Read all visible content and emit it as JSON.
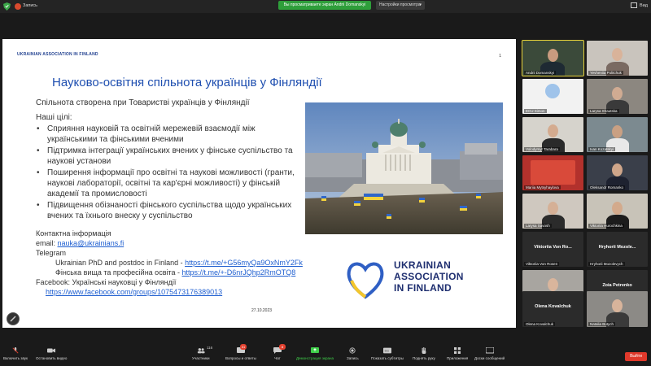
{
  "topbar": {
    "recording": "Запись",
    "share_notice": "Вы просматриваете экран Andrii Domanskyi",
    "view_options": "Настройки просмотра",
    "view_button": "Вид"
  },
  "slide": {
    "org": "UKRAINIAN ASSOCIATION IN FINLAND",
    "page": "1",
    "title": "Науково-освітня спільнота українців у Фінляндії",
    "intro": "Спільнота створена при Товаристві українців у Фінляндії",
    "goals_heading": "Наші цілі:",
    "goals": [
      "Сприяння науковій та освітній мережевій взаємодії між українськими та фінськими вченими",
      "Підтримка інтеграції українських вчених у фінське суспільство та наукові установи",
      "Поширення інформації про освітні та наукові можливості (гранти, наукові лабораторії, освітні та кар'єрні можливості) у фінській академії та промисловості",
      "Підвищення обізнаності фінського суспільства щодо українських вчених та їхнього внеску у суспільство"
    ],
    "contact_heading": "Контактна інформація",
    "email_label": "email: ",
    "email": "nauka@ukrainians.fi",
    "telegram_label": "Telegram",
    "tg1_label": "Ukrainian PhD and postdoc in Finland - ",
    "tg1_link": "https://t.me/+G56myQa9OxNmY2Fk",
    "tg2_label": "Фінська вища та професійна освіта - ",
    "tg2_link": "https://t.me/+-D6nrJQhp2RmOTQ8",
    "facebook_label": "Facebook: Українські науковці у Фінляндії",
    "facebook_link": "https://www.facebook.com/groups/1075473176389013",
    "date": "27.10.2023",
    "logo_line1": "UKRAINIAN",
    "logo_line2": "ASSOCIATION",
    "logo_line3": "IN FINLAND"
  },
  "participants": [
    {
      "name": "Andrii Domanskyi",
      "active": true
    },
    {
      "name": "Yevheniia Politchuk"
    },
    {
      "name": "ECU Simon"
    },
    {
      "name": "Larysa Shautska"
    },
    {
      "name": "Volodymyr Tarabara"
    },
    {
      "name": "Ivan Kozatskyi"
    },
    {
      "name": "Mariia Mytsyhaylova"
    },
    {
      "name": "Oleksandr Romanko"
    },
    {
      "name": "Larysa Savosh"
    },
    {
      "name": "Viktoriia Hurochkina"
    },
    {
      "name": "Viktoriia Von Rosen",
      "big": "Viktoriia Von Ro..."
    },
    {
      "name": "Hryhorii Mozolevych",
      "big": "Hryhorii Mozole..."
    },
    {
      "name": "Olena Zaika"
    },
    {
      "name": "Zoia Petrenko",
      "big": "Zoia Petrenko"
    },
    {
      "name": "Olena Kovalchuk",
      "big": "Olena Kovalchuk"
    },
    {
      "name": "Natalia Butych"
    }
  ],
  "toolbar": {
    "mute": "Включить звук",
    "video": "Остановить видео",
    "participants": "Участники",
    "participants_count": "116",
    "qa": "Вопросы и ответы",
    "qa_badge": "31",
    "chat": "Чат",
    "chat_badge": "8",
    "share": "Демонстрация экрана",
    "record": "Запись",
    "captions": "Показать субтитры",
    "raise": "Поднять руку",
    "apps": "Приложения",
    "whiteboard": "Доски сообщений",
    "leave": "Выйти"
  },
  "colors": {
    "share_green": "#2e9e3a",
    "slide_title_blue": "#1f4fb0",
    "leave_red": "#e0392b"
  }
}
